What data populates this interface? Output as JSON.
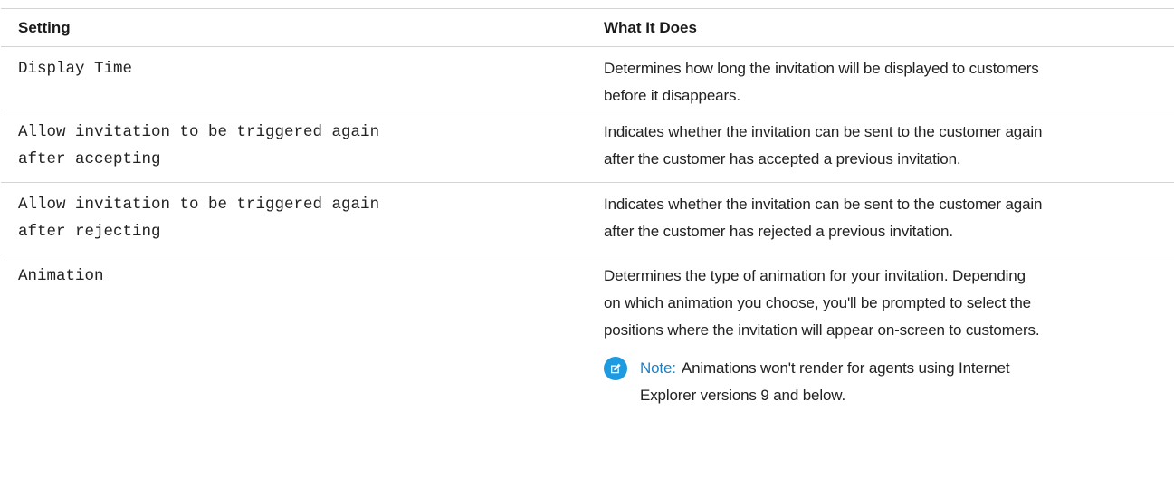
{
  "table": {
    "headers": {
      "setting": "Setting",
      "what_it_does": "What It Does"
    },
    "rows": [
      {
        "setting": [
          "Display Time"
        ],
        "description": [
          "Determines how long the invitation will be displayed to customers",
          "before it disappears."
        ]
      },
      {
        "setting": [
          "Allow invitation to be triggered again",
          "after accepting"
        ],
        "description": [
          "Indicates whether the invitation can be sent to the customer again",
          "after the customer has accepted a previous invitation."
        ]
      },
      {
        "setting": [
          "Allow invitation to be triggered again",
          "after rejecting"
        ],
        "description": [
          "Indicates whether the invitation can be sent to the customer again",
          "after the customer has rejected a previous invitation."
        ]
      },
      {
        "setting": [
          "Animation"
        ],
        "description": [
          "Determines the type of animation for your invitation. Depending",
          "on which animation you choose, you'll be prompted to select the",
          "positions where the invitation will appear on-screen to customers."
        ],
        "note": {
          "label": "Note:",
          "lines": [
            "Animations won't render for agents using Internet",
            "Explorer versions 9 and below."
          ]
        }
      }
    ]
  },
  "icons": {
    "note": "note-edit-icon"
  },
  "colors": {
    "note_icon_bg": "#1e9ae0",
    "note_label": "#1e7fc1",
    "rule": "#d4d4d4"
  }
}
